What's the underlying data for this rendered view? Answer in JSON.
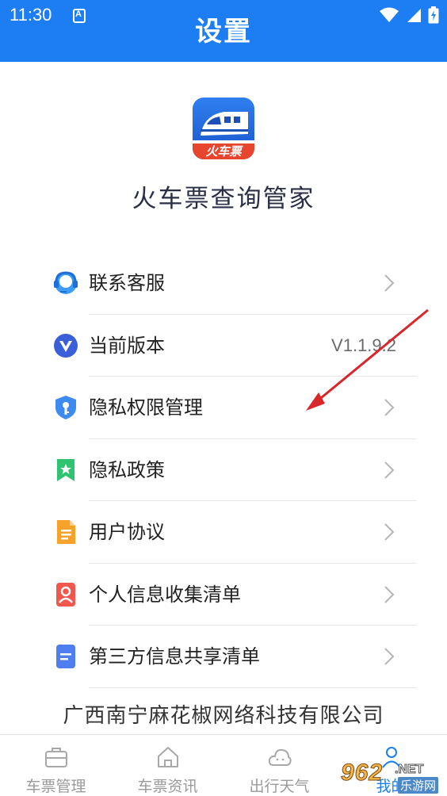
{
  "status_bar": {
    "time": "11:30",
    "notification_letter": "A"
  },
  "header": {
    "title": "设置"
  },
  "app": {
    "name": "火车票查询管家",
    "logo_text": "火车票"
  },
  "settings": [
    {
      "label": "联系客服",
      "icon": "headset-icon",
      "value": ""
    },
    {
      "label": "当前版本",
      "icon": "version-v-icon",
      "value": "V1.1.9.2"
    },
    {
      "label": "隐私权限管理",
      "icon": "shield-key-icon",
      "value": ""
    },
    {
      "label": "隐私政策",
      "icon": "bookmark-star-icon",
      "value": ""
    },
    {
      "label": "用户协议",
      "icon": "document-icon",
      "value": ""
    },
    {
      "label": "个人信息收集清单",
      "icon": "person-card-icon",
      "value": ""
    },
    {
      "label": "第三方信息共享清单",
      "icon": "list-doc-icon",
      "value": ""
    }
  ],
  "company": "广西南宁麻花椒网络科技有限公司",
  "bottom_nav": [
    {
      "label": "车票管理",
      "icon": "briefcase-icon"
    },
    {
      "label": "车票资讯",
      "icon": "house-icon"
    },
    {
      "label": "出行天气",
      "icon": "cloud-icon"
    },
    {
      "label": "我的",
      "icon": "person-icon"
    }
  ],
  "watermark": {
    "number": "962",
    "net": ".NET",
    "cn": "乐游网"
  },
  "colors": {
    "primary": "#1d7ef3",
    "header_text": "#ffffff",
    "annotation_arrow": "#d9262a"
  }
}
